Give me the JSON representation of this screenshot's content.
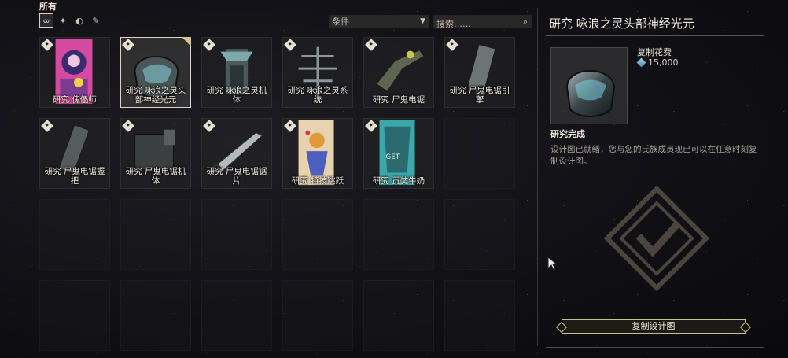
{
  "category_title": "所有",
  "filters": {
    "items": [
      {
        "icon": "infinity-icon",
        "glyph": "∞",
        "active": true
      },
      {
        "icon": "frame-icon",
        "glyph": "✦",
        "active": false
      },
      {
        "icon": "swirl-icon",
        "glyph": "◐",
        "active": false
      },
      {
        "icon": "feather-icon",
        "glyph": "✎",
        "active": false
      }
    ],
    "condition_label": "条件",
    "search_placeholder": "搜索……"
  },
  "grid": {
    "items": [
      {
        "label": "研究 傀儡师",
        "art": "poster-purple"
      },
      {
        "label": "研究 咏浪之灵头部神经光元",
        "art": "helmet",
        "selected": true
      },
      {
        "label": "研究 咏浪之灵机体",
        "art": "chassis"
      },
      {
        "label": "研究 咏浪之灵系统",
        "art": "systems"
      },
      {
        "label": "研究 尸鬼电锯",
        "art": "chainsaw"
      },
      {
        "label": "研究 尸鬼电锯引擎",
        "art": "engine"
      },
      {
        "label": "研究 尸鬼电锯握把",
        "art": "grip"
      },
      {
        "label": "研究 尸鬼电锯机体",
        "art": "block"
      },
      {
        "label": "研究 尸鬼电锯锯片",
        "art": "blade"
      },
      {
        "label": "研究 特技跳跃",
        "art": "poster-yellow"
      },
      {
        "label": "研究 贡奘牛奶",
        "art": "poster-teal"
      }
    ]
  },
  "detail": {
    "title": "研究 咏浪之灵头部神经光元",
    "cost_label": "复制花费",
    "cost_value": "15,000",
    "cost_icon": "platinum-icon",
    "status_title": "研究完成",
    "status_desc": "设计图已就绪，您与您的氏族成员现已可以在任意时刻复制设计图。",
    "button_label": "复制设计图"
  },
  "colors": {
    "accent": "#cbbf8e",
    "text": "#e6e0d2",
    "background": "#101015"
  }
}
